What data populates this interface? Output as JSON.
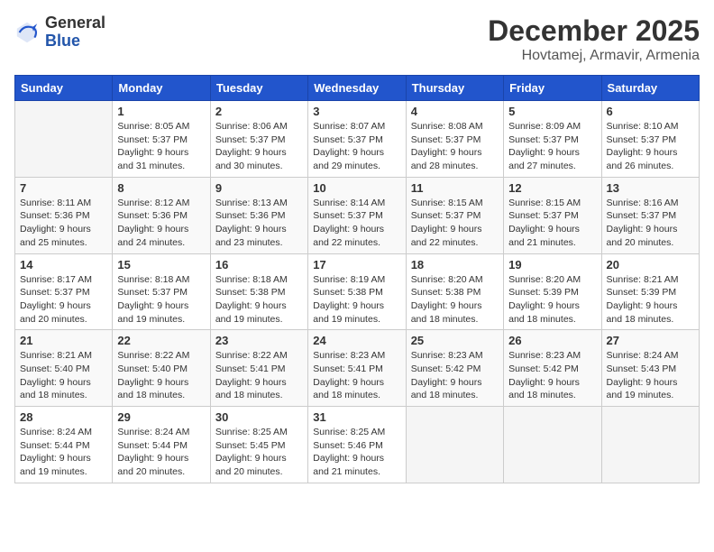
{
  "logo": {
    "general": "General",
    "blue": "Blue"
  },
  "header": {
    "month": "December 2025",
    "location": "Hovtamej, Armavir, Armenia"
  },
  "weekdays": [
    "Sunday",
    "Monday",
    "Tuesday",
    "Wednesday",
    "Thursday",
    "Friday",
    "Saturday"
  ],
  "weeks": [
    [
      {
        "day": "",
        "sunrise": "",
        "sunset": "",
        "daylight": ""
      },
      {
        "day": "1",
        "sunrise": "Sunrise: 8:05 AM",
        "sunset": "Sunset: 5:37 PM",
        "daylight": "Daylight: 9 hours and 31 minutes."
      },
      {
        "day": "2",
        "sunrise": "Sunrise: 8:06 AM",
        "sunset": "Sunset: 5:37 PM",
        "daylight": "Daylight: 9 hours and 30 minutes."
      },
      {
        "day": "3",
        "sunrise": "Sunrise: 8:07 AM",
        "sunset": "Sunset: 5:37 PM",
        "daylight": "Daylight: 9 hours and 29 minutes."
      },
      {
        "day": "4",
        "sunrise": "Sunrise: 8:08 AM",
        "sunset": "Sunset: 5:37 PM",
        "daylight": "Daylight: 9 hours and 28 minutes."
      },
      {
        "day": "5",
        "sunrise": "Sunrise: 8:09 AM",
        "sunset": "Sunset: 5:37 PM",
        "daylight": "Daylight: 9 hours and 27 minutes."
      },
      {
        "day": "6",
        "sunrise": "Sunrise: 8:10 AM",
        "sunset": "Sunset: 5:37 PM",
        "daylight": "Daylight: 9 hours and 26 minutes."
      }
    ],
    [
      {
        "day": "7",
        "sunrise": "Sunrise: 8:11 AM",
        "sunset": "Sunset: 5:36 PM",
        "daylight": "Daylight: 9 hours and 25 minutes."
      },
      {
        "day": "8",
        "sunrise": "Sunrise: 8:12 AM",
        "sunset": "Sunset: 5:36 PM",
        "daylight": "Daylight: 9 hours and 24 minutes."
      },
      {
        "day": "9",
        "sunrise": "Sunrise: 8:13 AM",
        "sunset": "Sunset: 5:36 PM",
        "daylight": "Daylight: 9 hours and 23 minutes."
      },
      {
        "day": "10",
        "sunrise": "Sunrise: 8:14 AM",
        "sunset": "Sunset: 5:37 PM",
        "daylight": "Daylight: 9 hours and 22 minutes."
      },
      {
        "day": "11",
        "sunrise": "Sunrise: 8:15 AM",
        "sunset": "Sunset: 5:37 PM",
        "daylight": "Daylight: 9 hours and 22 minutes."
      },
      {
        "day": "12",
        "sunrise": "Sunrise: 8:15 AM",
        "sunset": "Sunset: 5:37 PM",
        "daylight": "Daylight: 9 hours and 21 minutes."
      },
      {
        "day": "13",
        "sunrise": "Sunrise: 8:16 AM",
        "sunset": "Sunset: 5:37 PM",
        "daylight": "Daylight: 9 hours and 20 minutes."
      }
    ],
    [
      {
        "day": "14",
        "sunrise": "Sunrise: 8:17 AM",
        "sunset": "Sunset: 5:37 PM",
        "daylight": "Daylight: 9 hours and 20 minutes."
      },
      {
        "day": "15",
        "sunrise": "Sunrise: 8:18 AM",
        "sunset": "Sunset: 5:37 PM",
        "daylight": "Daylight: 9 hours and 19 minutes."
      },
      {
        "day": "16",
        "sunrise": "Sunrise: 8:18 AM",
        "sunset": "Sunset: 5:38 PM",
        "daylight": "Daylight: 9 hours and 19 minutes."
      },
      {
        "day": "17",
        "sunrise": "Sunrise: 8:19 AM",
        "sunset": "Sunset: 5:38 PM",
        "daylight": "Daylight: 9 hours and 19 minutes."
      },
      {
        "day": "18",
        "sunrise": "Sunrise: 8:20 AM",
        "sunset": "Sunset: 5:38 PM",
        "daylight": "Daylight: 9 hours and 18 minutes."
      },
      {
        "day": "19",
        "sunrise": "Sunrise: 8:20 AM",
        "sunset": "Sunset: 5:39 PM",
        "daylight": "Daylight: 9 hours and 18 minutes."
      },
      {
        "day": "20",
        "sunrise": "Sunrise: 8:21 AM",
        "sunset": "Sunset: 5:39 PM",
        "daylight": "Daylight: 9 hours and 18 minutes."
      }
    ],
    [
      {
        "day": "21",
        "sunrise": "Sunrise: 8:21 AM",
        "sunset": "Sunset: 5:40 PM",
        "daylight": "Daylight: 9 hours and 18 minutes."
      },
      {
        "day": "22",
        "sunrise": "Sunrise: 8:22 AM",
        "sunset": "Sunset: 5:40 PM",
        "daylight": "Daylight: 9 hours and 18 minutes."
      },
      {
        "day": "23",
        "sunrise": "Sunrise: 8:22 AM",
        "sunset": "Sunset: 5:41 PM",
        "daylight": "Daylight: 9 hours and 18 minutes."
      },
      {
        "day": "24",
        "sunrise": "Sunrise: 8:23 AM",
        "sunset": "Sunset: 5:41 PM",
        "daylight": "Daylight: 9 hours and 18 minutes."
      },
      {
        "day": "25",
        "sunrise": "Sunrise: 8:23 AM",
        "sunset": "Sunset: 5:42 PM",
        "daylight": "Daylight: 9 hours and 18 minutes."
      },
      {
        "day": "26",
        "sunrise": "Sunrise: 8:23 AM",
        "sunset": "Sunset: 5:42 PM",
        "daylight": "Daylight: 9 hours and 18 minutes."
      },
      {
        "day": "27",
        "sunrise": "Sunrise: 8:24 AM",
        "sunset": "Sunset: 5:43 PM",
        "daylight": "Daylight: 9 hours and 19 minutes."
      }
    ],
    [
      {
        "day": "28",
        "sunrise": "Sunrise: 8:24 AM",
        "sunset": "Sunset: 5:44 PM",
        "daylight": "Daylight: 9 hours and 19 minutes."
      },
      {
        "day": "29",
        "sunrise": "Sunrise: 8:24 AM",
        "sunset": "Sunset: 5:44 PM",
        "daylight": "Daylight: 9 hours and 20 minutes."
      },
      {
        "day": "30",
        "sunrise": "Sunrise: 8:25 AM",
        "sunset": "Sunset: 5:45 PM",
        "daylight": "Daylight: 9 hours and 20 minutes."
      },
      {
        "day": "31",
        "sunrise": "Sunrise: 8:25 AM",
        "sunset": "Sunset: 5:46 PM",
        "daylight": "Daylight: 9 hours and 21 minutes."
      },
      {
        "day": "",
        "sunrise": "",
        "sunset": "",
        "daylight": ""
      },
      {
        "day": "",
        "sunrise": "",
        "sunset": "",
        "daylight": ""
      },
      {
        "day": "",
        "sunrise": "",
        "sunset": "",
        "daylight": ""
      }
    ]
  ]
}
